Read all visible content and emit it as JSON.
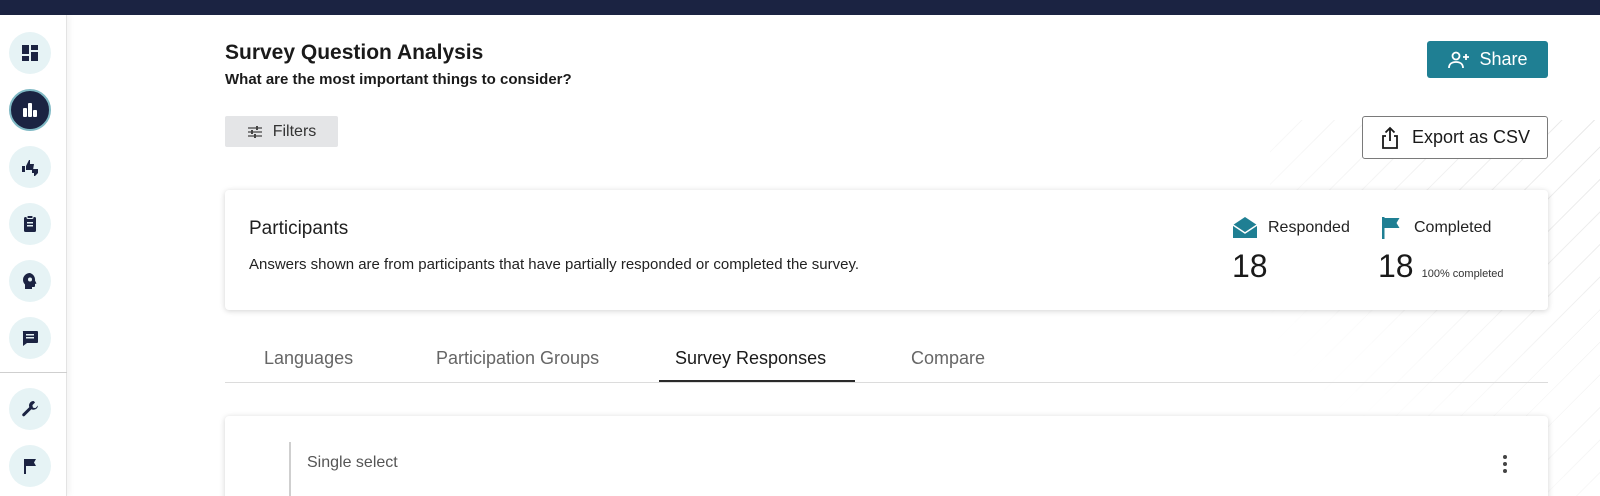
{
  "header": {
    "title": "Survey Question Analysis",
    "subtitle": "What are the most important things to consider?"
  },
  "buttons": {
    "share": "Share",
    "filters": "Filters",
    "export": "Export as CSV"
  },
  "sidebar": {
    "items": [
      {
        "icon": "dashboard-icon",
        "active": false
      },
      {
        "icon": "bar-chart-icon",
        "active": true
      },
      {
        "icon": "thumbs-icon",
        "active": false
      },
      {
        "icon": "clipboard-icon",
        "active": false
      },
      {
        "icon": "idea-head-icon",
        "active": false
      },
      {
        "icon": "chat-icon",
        "active": false
      },
      {
        "icon": "wrench-icon",
        "active": false
      },
      {
        "icon": "flag-icon",
        "active": false
      }
    ]
  },
  "participants": {
    "title": "Participants",
    "description": "Answers shown are from participants that have partially responded or completed the survey.",
    "responded": {
      "label": "Responded",
      "value": "18"
    },
    "completed": {
      "label": "Completed",
      "value": "18",
      "note": "100% completed"
    }
  },
  "tabs": [
    {
      "label": "Languages",
      "active": false
    },
    {
      "label": "Participation Groups",
      "active": false
    },
    {
      "label": "Survey Responses",
      "active": true
    },
    {
      "label": "Compare",
      "active": false
    }
  ],
  "response_card": {
    "label": "Single select"
  },
  "colors": {
    "topbar": "#1b2342",
    "accent": "#1f7f93",
    "sidebar_button_bg": "#e6f3f5"
  }
}
